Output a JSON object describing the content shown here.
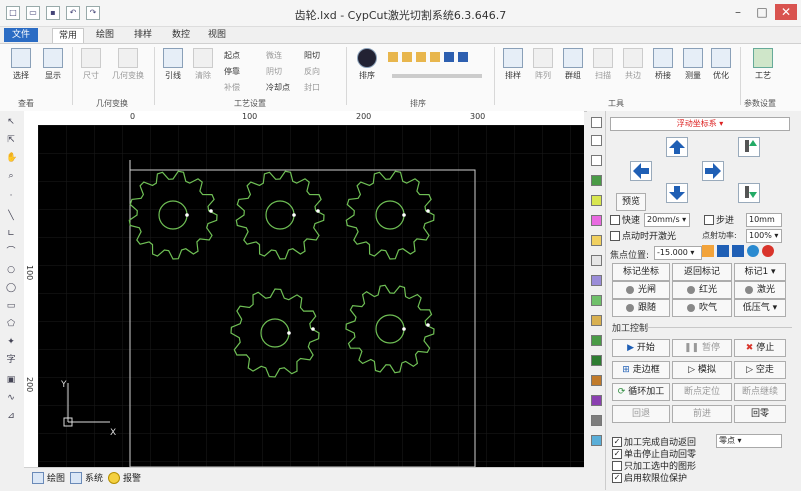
{
  "window": {
    "title": "齿轮.lxd - CypCut激光切割系统6.3.646.7"
  },
  "tabs": [
    "文件",
    "常用",
    "绘图",
    "排样",
    "数控",
    "视图"
  ],
  "ribbon": {
    "buttons_big": {
      "select": "选择",
      "show": "显示",
      "size": "尺寸",
      "geo_transform": "几何变换",
      "lead": "引线",
      "clear": "清除",
      "sort": "排序",
      "arrange": "排样",
      "array": "阵列",
      "group": "群组",
      "scan": "扫描",
      "common_edge": "共边",
      "bridge": "桥接",
      "measure": "测量",
      "optimize": "优化",
      "process": "工艺"
    },
    "small": {
      "start_point": "起点",
      "stop": "停靠",
      "compensation": "补偿",
      "micro_joint": "微连",
      "cooling_point": "冷却点",
      "reverse": "反向",
      "ring_cut": "环切",
      "closed": "封口",
      "distinguish": "阳切",
      "negative": "阴切"
    },
    "groups": {
      "view": "查看",
      "geo": "几何变换",
      "process_settings": "工艺设置",
      "sort": "排序",
      "tools": "工具",
      "param": "参数设置"
    }
  },
  "ruler": {
    "h": [
      "0",
      "100",
      "200",
      "300"
    ],
    "v": [
      "100",
      "200"
    ]
  },
  "canvas": {
    "axis_x": "X",
    "axis_y": "Y"
  },
  "bottom_tabs": [
    "绘图",
    "系统",
    "报警"
  ],
  "panel": {
    "coord_system": "浮动坐标系",
    "preview": "预览",
    "fast_label": "快速",
    "fast_speed": "20mm/s",
    "step_label": "步进",
    "step_value": "10mm",
    "laser_on_click": "点动时开激光",
    "power_label": "点射功率:",
    "power_value": "100%",
    "focus_label": "焦点位置:",
    "focus_value": "-15.000",
    "mark_coord": "标记坐标",
    "return_mark": "返回标记",
    "mark1": "标记1",
    "shutter": "光闸",
    "red_light": "红光",
    "laser": "激光",
    "follow": "跟随",
    "blow": "吹气",
    "low_gas": "低压气",
    "process_control": "加工控制",
    "start": "开始",
    "pause": "暂停",
    "stop": "停止",
    "frame": "走边框",
    "simulate": "模拟",
    "dry_run": "空走",
    "loop": "循环加工",
    "bp_locate": "断点定位",
    "bp_continue": "断点继续",
    "retreat": "回退",
    "forward": "前进",
    "return_zero": "回零",
    "check1": "加工完成自动返回",
    "check2": "单击停止自动回零",
    "check3": "只加工选中的图形",
    "check4": "启用软限位保护",
    "return_target": "零点"
  },
  "colors": {
    "canvas": "#000000",
    "gear": "#6fbf55",
    "accent": "#2b6cc4",
    "stop": "#d9342b"
  }
}
